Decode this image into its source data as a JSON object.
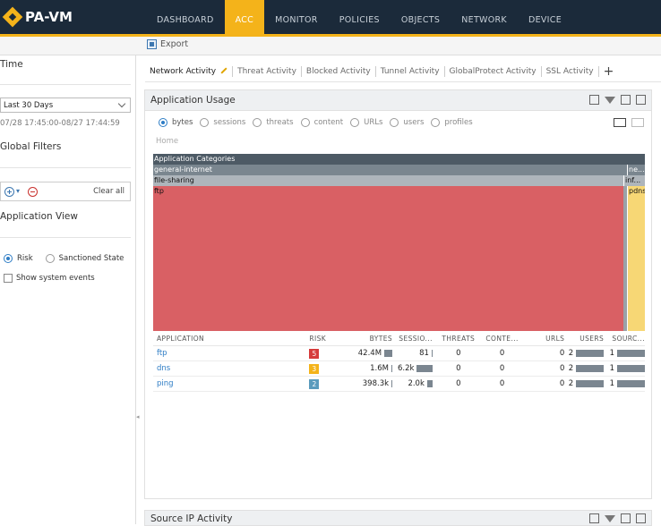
{
  "app": {
    "logo_text": "PA-VM"
  },
  "nav": {
    "tabs": [
      {
        "label": "DASHBOARD"
      },
      {
        "label": "ACC"
      },
      {
        "label": "MONITOR"
      },
      {
        "label": "POLICIES"
      },
      {
        "label": "OBJECTS"
      },
      {
        "label": "NETWORK"
      },
      {
        "label": "DEVICE"
      }
    ],
    "active": "ACC"
  },
  "toolbar": {
    "export_label": "Export"
  },
  "sidebar": {
    "time_heading": "Time",
    "time_range_selected": "Last 30 Days",
    "time_range_span": "07/28 17:45:00-08/27 17:44:59",
    "global_filters_heading": "Global Filters",
    "clear_all_label": "Clear all",
    "app_view_heading": "Application View",
    "view_options": [
      {
        "label": "Risk",
        "selected": true
      },
      {
        "label": "Sanctioned State",
        "selected": false
      }
    ],
    "show_system_events_label": "Show system events",
    "show_system_events_checked": false
  },
  "acc_tabs": [
    {
      "label": "Network Activity",
      "active": true
    },
    {
      "label": "Threat Activity"
    },
    {
      "label": "Blocked Activity"
    },
    {
      "label": "Tunnel Activity"
    },
    {
      "label": "GlobalProtect Activity"
    },
    {
      "label": "SSL Activity"
    }
  ],
  "app_usage": {
    "title": "Application Usage",
    "metrics": [
      {
        "label": "bytes",
        "selected": true
      },
      {
        "label": "sessions"
      },
      {
        "label": "threats"
      },
      {
        "label": "content"
      },
      {
        "label": "URLs"
      },
      {
        "label": "users"
      },
      {
        "label": "profiles"
      }
    ],
    "breadcrumb_home": "Home",
    "treemap": {
      "root_label": "Application Categories",
      "level1": [
        {
          "label": "general-internet"
        },
        {
          "label": "ne..."
        }
      ],
      "level2": [
        {
          "label": "file-sharing"
        },
        {
          "label": "inf..."
        }
      ],
      "level3": [
        {
          "label": "ftp"
        },
        {
          "label": "pdns"
        }
      ]
    },
    "table": {
      "headers": [
        "APPLICATION",
        "RISK",
        "BYTES",
        "SESSIO...",
        "THREATS",
        "CONTE...",
        "URLS",
        "USERS",
        "SOURC..."
      ],
      "rows": [
        {
          "app": "ftp",
          "risk": "5",
          "risk_color": "#d63b3b",
          "bytes": "42.4M",
          "bytes_fraction": 1.0,
          "sessions": "81",
          "sessions_fraction": 0.0,
          "threats": "0",
          "content": "0",
          "urls": "0",
          "users": "2",
          "sources": "1"
        },
        {
          "app": "dns",
          "risk": "3",
          "risk_color": "#f4b31a",
          "bytes": "1.6M",
          "bytes_fraction": 0.0,
          "sessions": "6.2k",
          "sessions_fraction": 1.0,
          "threats": "0",
          "content": "0",
          "urls": "0",
          "users": "2",
          "sources": "1"
        },
        {
          "app": "ping",
          "risk": "2",
          "risk_color": "#5a9bbd",
          "bytes": "398.3k",
          "bytes_fraction": 0.0,
          "sessions": "2.0k",
          "sessions_fraction": 0.32,
          "threats": "0",
          "content": "0",
          "urls": "0",
          "users": "2",
          "sources": "1"
        }
      ]
    }
  },
  "source_ip_activity": {
    "title": "Source IP Activity"
  }
}
